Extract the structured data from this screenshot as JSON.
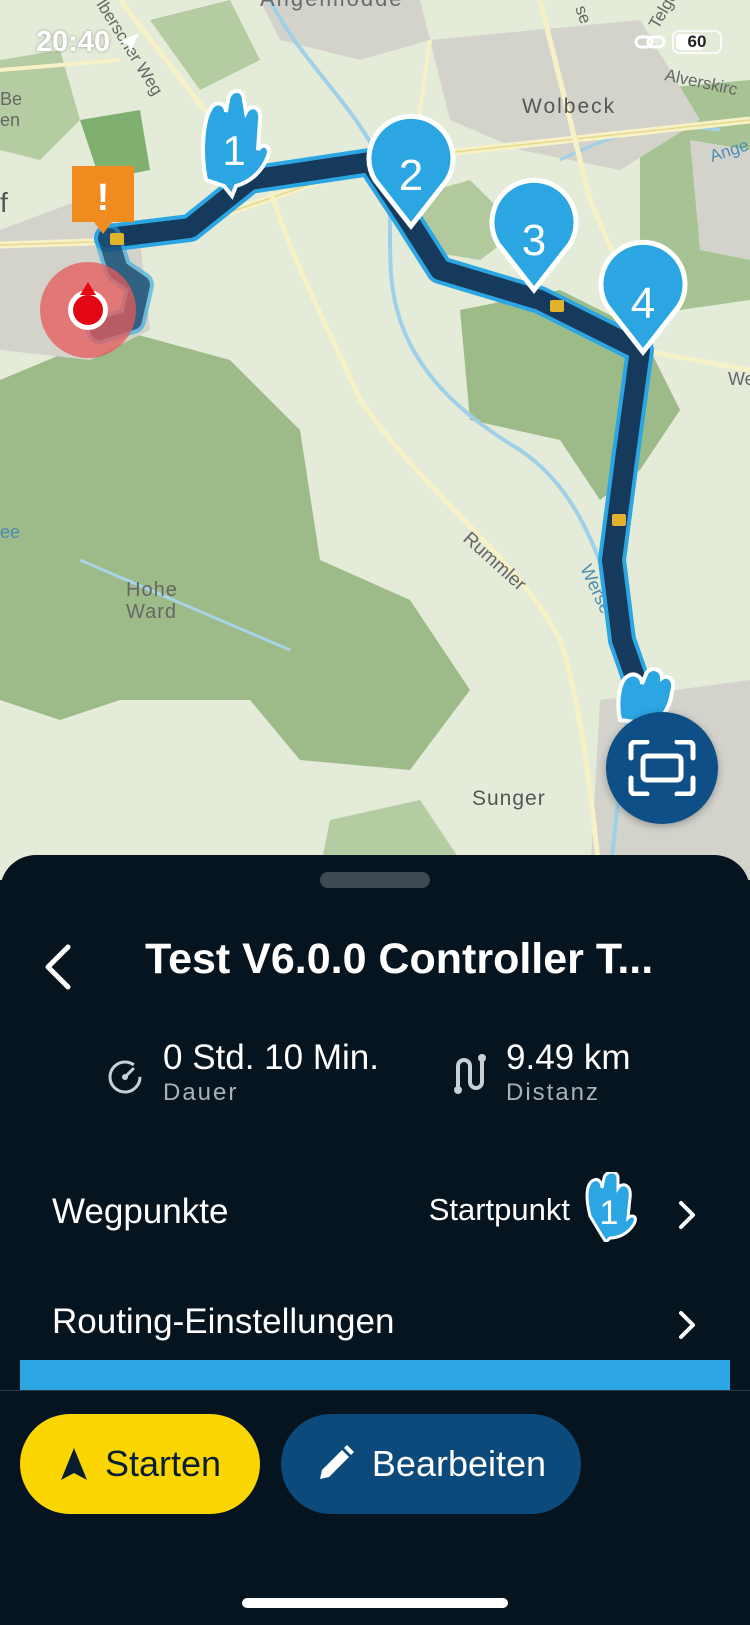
{
  "status_bar": {
    "time": "20:40",
    "battery": "60"
  },
  "map": {
    "labels": {
      "angelmodde": "Angelmodde",
      "wolbeck": "Wolbeck",
      "alverskirchen": "Alverskirc",
      "hohe_ward_1": "Hohe",
      "hohe_ward_2": "Ward",
      "rummler": "Rummler",
      "werse": "Werse",
      "sunger": "Sunger",
      "be": "Be",
      "en": "en",
      "f": "f",
      "ee": "ee",
      "we": "We",
      "ange": "Ange",
      "telge": "Telge",
      "se": "se",
      "berger_weg": "lberscher Weg"
    },
    "waypoints": [
      "1",
      "2",
      "3",
      "4"
    ],
    "warning_glyph": "!"
  },
  "sheet": {
    "title": "Test V6.0.0 Controller T...",
    "duration_value": "0 Std. 10 Min.",
    "duration_label": "Dauer",
    "distance_value": "9.49 km",
    "distance_label": "Distanz",
    "waypoints_label": "Wegpunkte",
    "waypoints_value": "Startpunkt",
    "waypoints_icon_number": "1",
    "routing_label": "Routing-Einstellungen"
  },
  "actions": {
    "start_label": "Starten",
    "edit_label": "Bearbeiten"
  },
  "colors": {
    "accent_yellow": "#fcd600",
    "route_blue": "#2ba6e3",
    "dark_bg": "#06141f",
    "edit_blue": "#0d4a7c"
  }
}
